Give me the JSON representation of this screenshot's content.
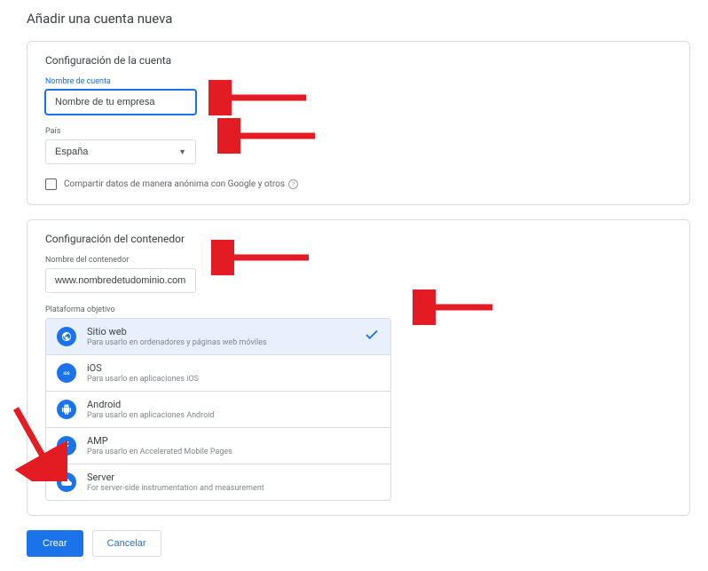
{
  "page_title": "Añadir una cuenta nueva",
  "account": {
    "section_title": "Configuración de la cuenta",
    "name_label": "Nombre de cuenta",
    "name_value": "Nombre de tu empresa",
    "country_label": "País",
    "country_value": "España",
    "share_label": "Compartir datos de manera anónima con Google y otros"
  },
  "container": {
    "section_title": "Configuración del contenedor",
    "name_label": "Nombre del contenedor",
    "name_value": "www.nombredetudominio.com",
    "platform_label": "Plataforma objetivo",
    "platforms": [
      {
        "name": "Sitio web",
        "desc": "Para usarlo en ordenadores y páginas web móviles",
        "selected": true
      },
      {
        "name": "iOS",
        "desc": "Para usarlo en aplicaciones iOS",
        "selected": false
      },
      {
        "name": "Android",
        "desc": "Para usarlo en aplicaciones Android",
        "selected": false
      },
      {
        "name": "AMP",
        "desc": "Para usarlo en Accelerated Mobile Pages",
        "selected": false
      },
      {
        "name": "Server",
        "desc": "For server-side instrumentation and measurement",
        "selected": false
      }
    ]
  },
  "buttons": {
    "create": "Crear",
    "cancel": "Cancelar"
  }
}
